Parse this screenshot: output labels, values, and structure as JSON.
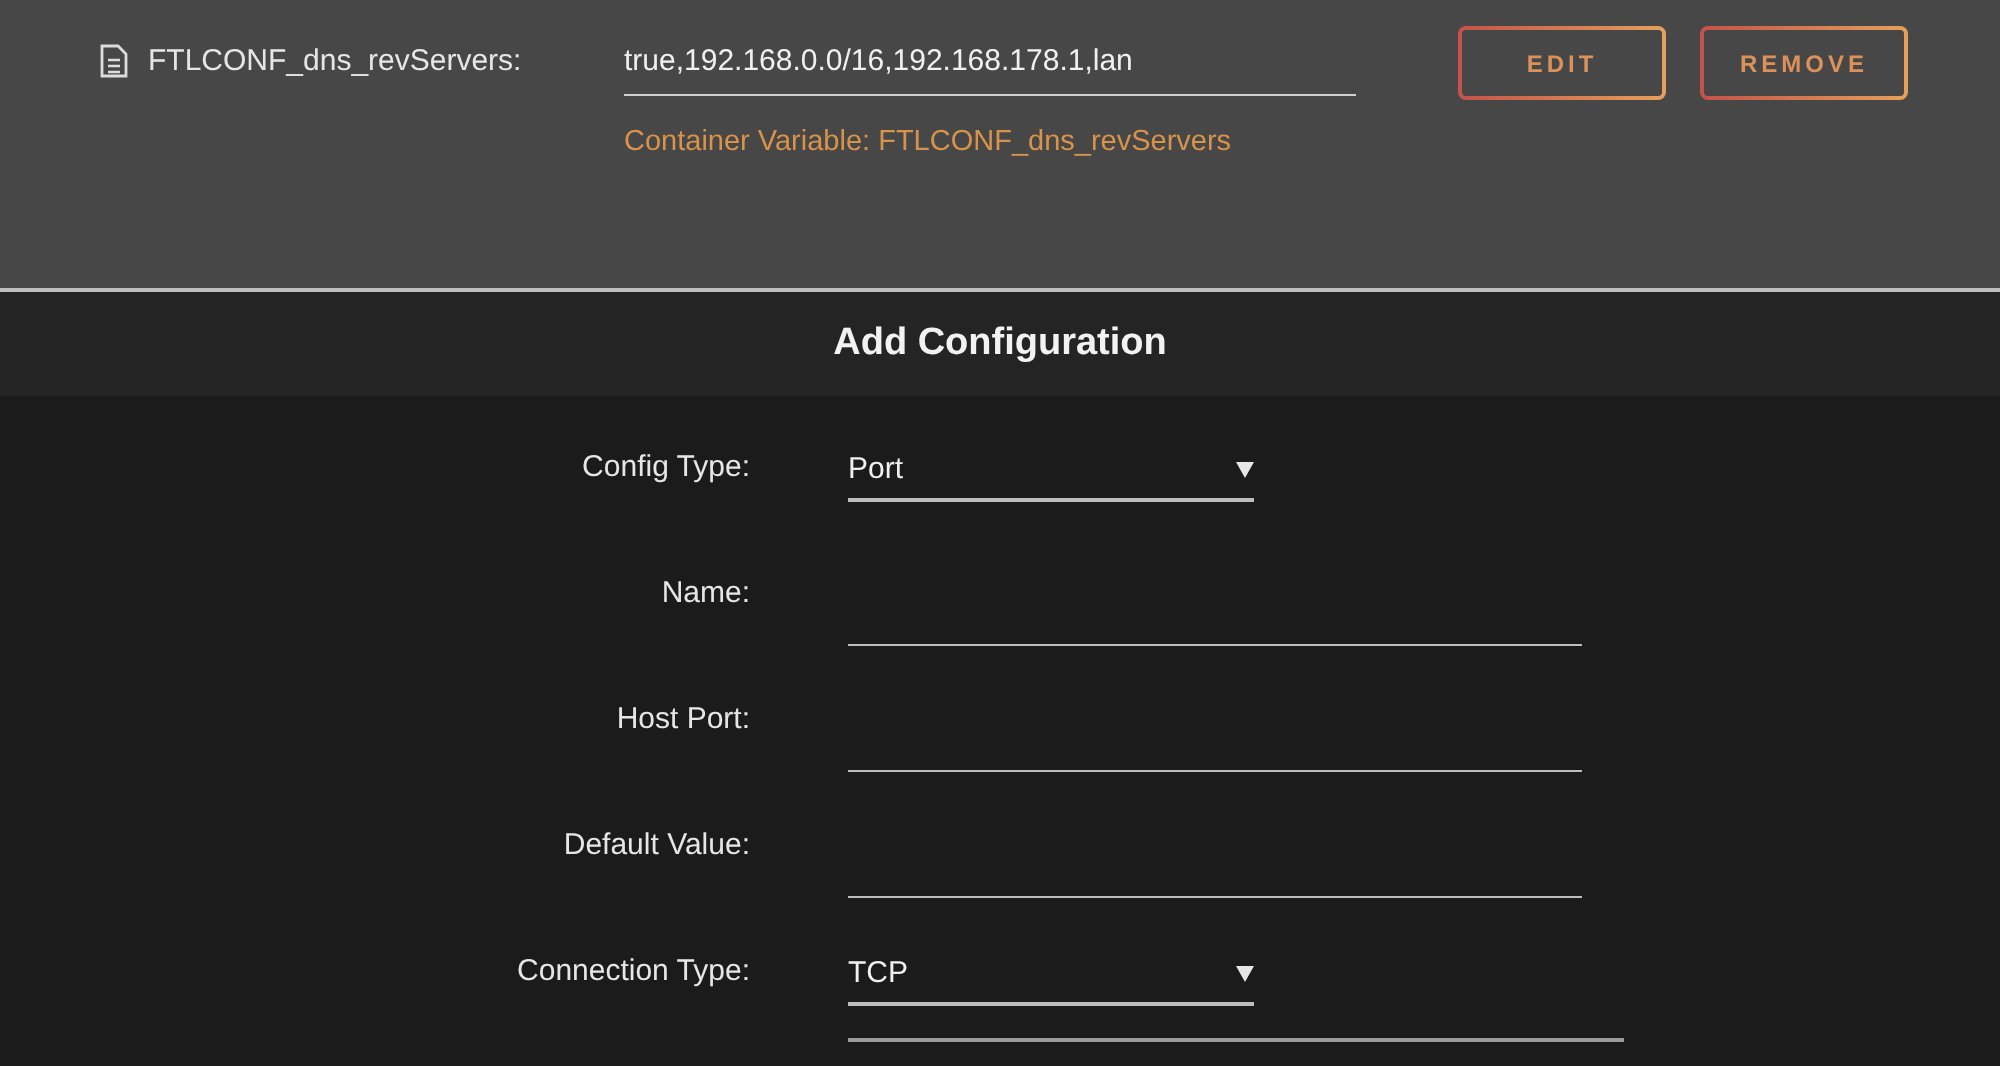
{
  "variable": {
    "label": "FTLCONF_dns_revServers:",
    "value": "true,192.168.0.0/16,192.168.178.1,lan",
    "caption": "Container Variable: FTLCONF_dns_revServers",
    "buttons": [
      "EDIT",
      "REMOVE"
    ]
  },
  "add_configuration": {
    "title": "Add Configuration",
    "fields": [
      {
        "label": "Config Type:",
        "kind": "select",
        "value": "Port"
      },
      {
        "label": "Name:",
        "kind": "text"
      },
      {
        "label": "Host Port:",
        "kind": "text"
      },
      {
        "label": "Default Value:",
        "kind": "text"
      },
      {
        "label": "Connection Type:",
        "kind": "select",
        "value": "TCP"
      }
    ]
  }
}
